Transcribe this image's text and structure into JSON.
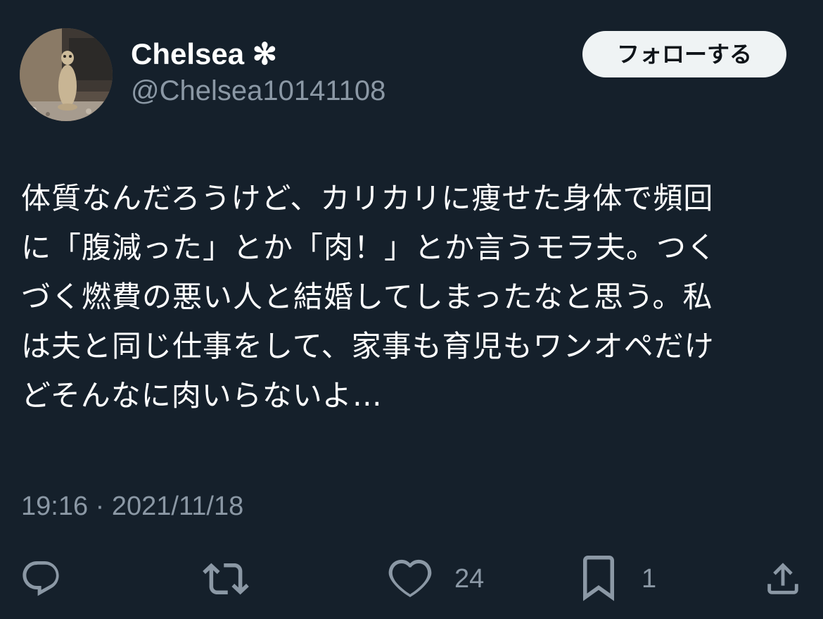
{
  "user": {
    "display_name": "Chelsea ✻",
    "handle": "@Chelsea10141108"
  },
  "follow_button": {
    "label": "フォローする"
  },
  "tweet": {
    "lines": [
      "体質なんだろうけど、カリカリに痩せた身体で頻回",
      "に「腹減った」とか「肉！」とか言うモラ夫。つく",
      "づく燃費の悪い人と結婚してしまったなと思う。私",
      "は夫と同じ仕事をして、家事も育児もワンオペだけ",
      "どそんなに肉いらないよ…"
    ],
    "time": "19:16",
    "separator": "·",
    "date": "2021/11/18"
  },
  "actions": {
    "reply": {
      "icon": "reply-icon",
      "count": ""
    },
    "retweet": {
      "icon": "retweet-icon",
      "count": ""
    },
    "like": {
      "icon": "heart-icon",
      "count": "24"
    },
    "bookmark": {
      "icon": "bookmark-icon",
      "count": "1"
    },
    "share": {
      "icon": "share-icon",
      "count": ""
    }
  },
  "colors": {
    "background": "#15202b",
    "text_primary": "#ffffff",
    "text_secondary": "#8b98a5",
    "follow_button_bg": "#eff3f4",
    "follow_button_text": "#0f1419"
  }
}
